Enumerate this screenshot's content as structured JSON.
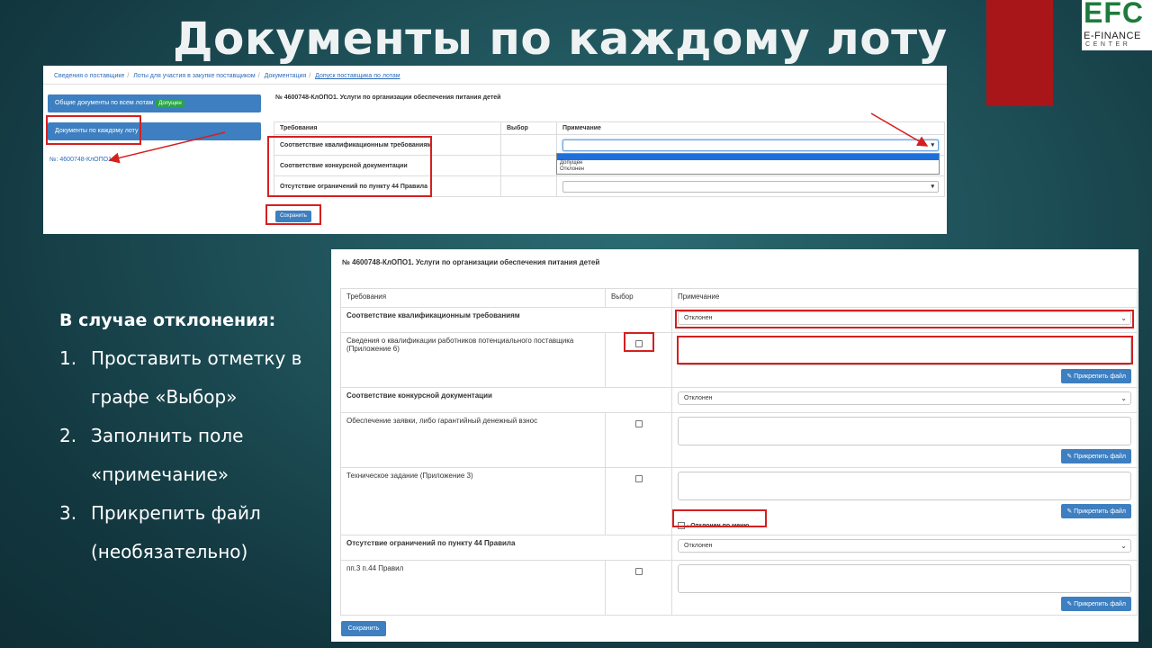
{
  "slide": {
    "title": "Документы по каждому лоту",
    "logo": {
      "main": "EFC",
      "line1": "E-FINANCE",
      "line2": "CENTER"
    },
    "instructions": {
      "heading": "В случае отклонения:",
      "steps": [
        {
          "num": "1.",
          "text": "Проставить отметку в графе «Выбор»"
        },
        {
          "num": "2.",
          "text": "Заполнить поле «примечание»"
        },
        {
          "num": "3.",
          "text": "Прикрепить файл (необязательно)"
        }
      ]
    }
  },
  "screen1": {
    "breadcrumb": [
      "Сведения о поставщике",
      "Лоты для участия в закупке поставщиком",
      "Документация",
      "Допуск поставщика по лотам"
    ],
    "sidebar": {
      "all_docs_label": "Общие документы по всем лотам",
      "all_docs_badge": "Допущен",
      "each_lot_label": "Документы по каждому лоту",
      "lot_link": "№: 4600748-КлОПО1"
    },
    "heading": "№ 4600748-КлОПО1. Услуги по организации обеспечения питания детей",
    "columns": [
      "Требования",
      "Выбор",
      "Примечание"
    ],
    "rows": [
      "Соответствие квалификационным требованиям",
      "Соответствие конкурсной документации",
      "Отсутствие ограничений по пункту 44 Правила"
    ],
    "dropdown_options": [
      "Допущен",
      "Отклонен"
    ],
    "save_label": "Сохранить"
  },
  "screen2": {
    "heading": "№ 4600748-КлОПО1. Услуги по организации обеспечения питания детей",
    "columns": [
      "Требования",
      "Выбор",
      "Примечание"
    ],
    "sections": [
      {
        "title": "Соответствие квалификационным требованиям",
        "status": "Отклонен",
        "items": [
          {
            "text": "Сведения о квалификации работников потенциального поставщика (Приложение 6)"
          }
        ]
      },
      {
        "title": "Соответствие конкурсной документации",
        "status": "Отклонен",
        "items": [
          {
            "text": "Обеспечение заявки, либо гарантийный денежный взнос"
          },
          {
            "text": "Техническое задание (Приложение 3)"
          }
        ]
      },
      {
        "title": "Отсутствие ограничений по пункту 44 Правила",
        "status": "Отклонен",
        "items": [
          {
            "text": "пп.3 п.44 Правил"
          }
        ]
      }
    ],
    "attach_label": "✎ Прикрепить файл",
    "reject_by_menu": "- Отклонен по меню",
    "save_label": "Сохранить"
  }
}
